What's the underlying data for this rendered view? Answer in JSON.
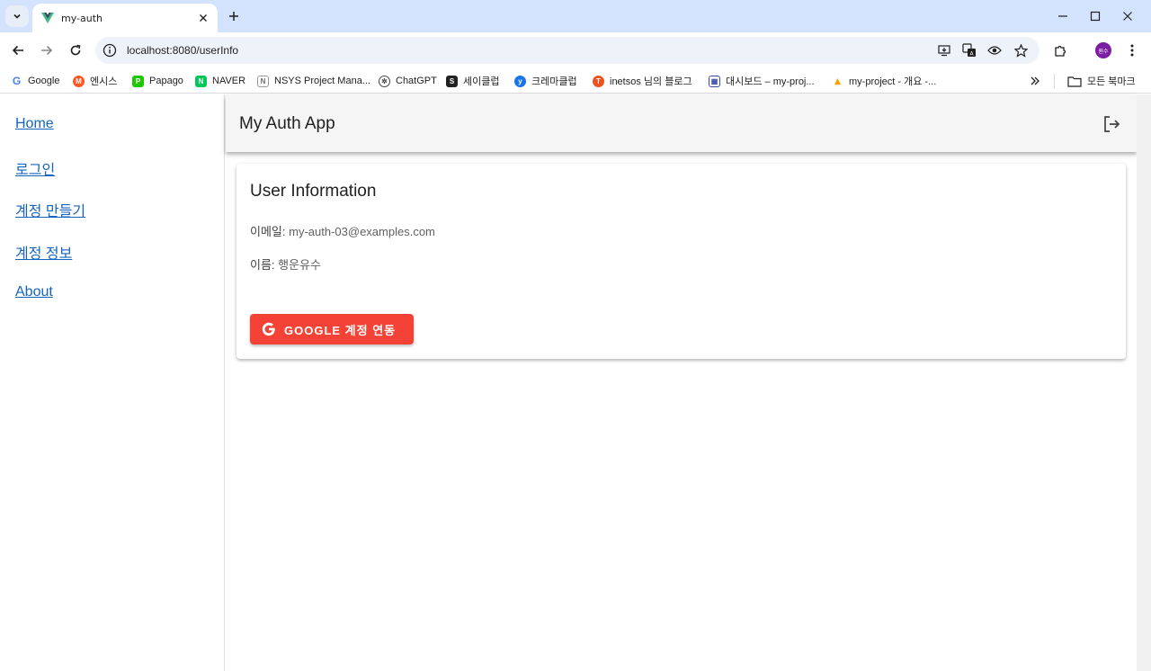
{
  "browser": {
    "tab": {
      "title": "my-auth"
    },
    "address": {
      "url": "localhost:8080/userInfo"
    },
    "profile_initials": "원수",
    "bookmarks": [
      {
        "label": "Google",
        "icon": "google-icon",
        "color": "#4285f4"
      },
      {
        "label": "엔시스",
        "icon": "m-icon",
        "color": "#ff5722"
      },
      {
        "label": "Papago",
        "icon": "papago-icon",
        "color": "#1ec800"
      },
      {
        "label": "NAVER",
        "icon": "naver-icon",
        "color": "#03c75a"
      },
      {
        "label": "NSYS Project Mana...",
        "icon": "nsys-icon",
        "color": "#6d6d6d"
      },
      {
        "label": "ChatGPT",
        "icon": "chatgpt-icon",
        "color": "#444444"
      },
      {
        "label": "세이클럽",
        "icon": "sayclub-icon",
        "color": "#222222"
      },
      {
        "label": "크레마클럽",
        "icon": "crema-icon",
        "color": "#1a73e8"
      },
      {
        "label": "inetsos 님의 블로그",
        "icon": "tistory-icon",
        "color": "#eb531f"
      },
      {
        "label": "대시보드 – my-proj...",
        "icon": "dashboard-icon",
        "color": "#3c4ba0"
      },
      {
        "label": "my-project - 개요 -...",
        "icon": "firebase-icon",
        "color": "#ffa000"
      }
    ],
    "all_bookmarks_label": "모든 북마크"
  },
  "sidebar": {
    "items": [
      {
        "label": "Home"
      },
      {
        "label": "로그인"
      },
      {
        "label": "계정 만들기"
      },
      {
        "label": "계정 정보"
      },
      {
        "label": "About"
      }
    ]
  },
  "appbar": {
    "title": "My Auth App",
    "logout_icon": "logout-icon"
  },
  "card": {
    "title": "User Information",
    "email_label": "이메일:",
    "email_value": "my-auth-03@examples.com",
    "name_label": "이름:",
    "name_value": "행운유수",
    "google_button_label": "GOOGLE 계정 연동"
  },
  "colors": {
    "tabstrip": "#d3e3fd",
    "link": "#1565c0",
    "appbar": "#f5f5f5",
    "google_button": "#f44336",
    "profile": "#7b1fa2"
  }
}
